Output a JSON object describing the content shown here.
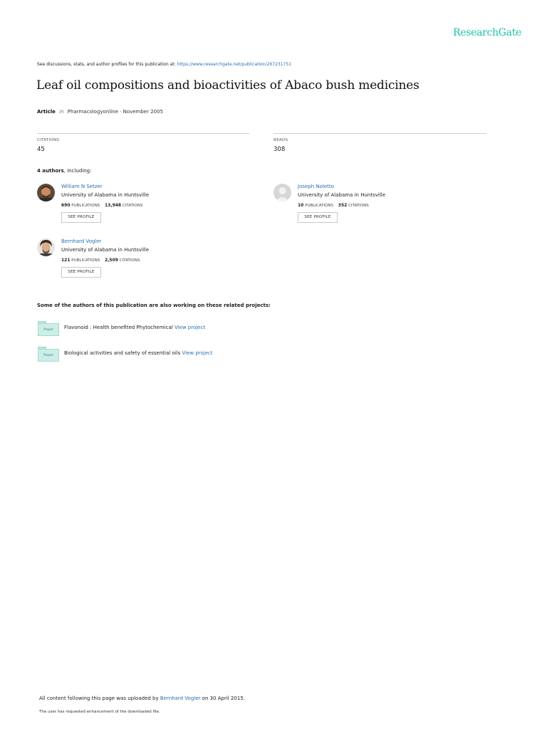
{
  "brand": {
    "name": "ResearchGate",
    "color": "#19c3a8"
  },
  "link_color": "#2a6fb2",
  "header": {
    "discussion_text": "See discussions, stats, and author profiles for this publication at:",
    "publication_url": "https://www.researchgate.net/publication/267231751"
  },
  "publication": {
    "title": "Leaf oil compositions and bioactivities of Abaco bush medicines",
    "type": "Article",
    "in_word": "in",
    "journal_date": "Pharmacologyonline · November 2005"
  },
  "stats": {
    "citations_label": "CITATIONS",
    "citations_value": "45",
    "reads_label": "READS",
    "reads_value": "308"
  },
  "authors_section": {
    "count_label": "4 authors",
    "suffix": ", including:"
  },
  "authors": [
    {
      "name": "William N Setzer",
      "institution": "University of Alabama in Huntsville",
      "publications": "690",
      "publications_label": "PUBLICATIONS",
      "citations": "13,948",
      "citations_label": "CITATIONS",
      "button": "SEE PROFILE"
    },
    {
      "name": "Joseph Noletto",
      "institution": "University of Alabama in Huntsville",
      "publications": "10",
      "publications_label": "PUBLICATIONS",
      "citations": "352",
      "citations_label": "CITATIONS",
      "button": "SEE PROFILE"
    },
    {
      "name": "Bernhard Vogler",
      "institution": "University of Alabama in Huntsville",
      "publications": "121",
      "publications_label": "PUBLICATIONS",
      "citations": "2,509",
      "citations_label": "CITATIONS",
      "button": "SEE PROFILE"
    }
  ],
  "related": {
    "heading": "Some of the authors of this publication are also working on these related projects:",
    "projects": [
      {
        "icon_label": "Project",
        "text": "Flavonoid : Health benefited Phytochemical",
        "link": "View project"
      },
      {
        "icon_label": "Project",
        "text": "Biological activities and safety of essential oils",
        "link": "View project"
      }
    ]
  },
  "footer": {
    "uploaded_prefix": "All content following this page was uploaded by",
    "uploader": "Bernhard Vogler",
    "uploaded_suffix": "on 30 April 2015.",
    "enhancement_note": "The user has requested enhancement of the downloaded file."
  }
}
